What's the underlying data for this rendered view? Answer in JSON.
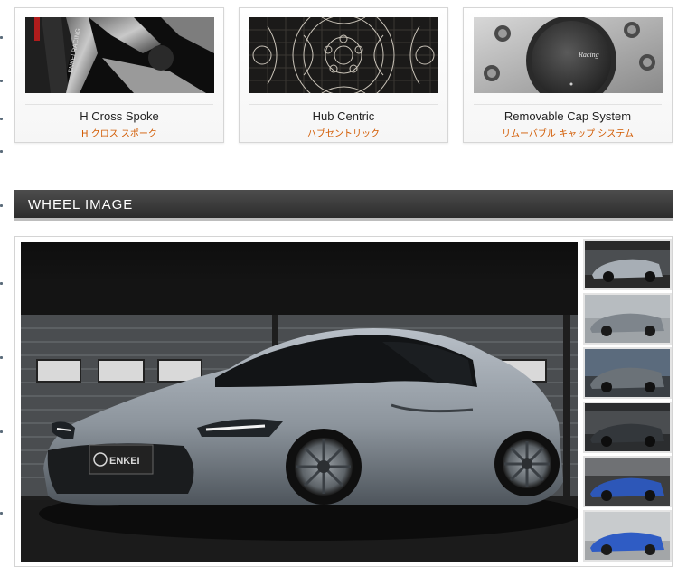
{
  "features": [
    {
      "title": "H Cross Spoke",
      "subtitle": "H クロス スポーク",
      "image": "wheel-spoke-closeup"
    },
    {
      "title": "Hub Centric",
      "subtitle": "ハブセントリック",
      "image": "hub-centric-diagram"
    },
    {
      "title": "Removable Cap System",
      "subtitle": "リムーバブル キャップ システム",
      "image": "wheel-center-cap",
      "cap_text": "Racing"
    }
  ],
  "section": {
    "title": "WHEEL IMAGE"
  },
  "gallery": {
    "main_image": "grey-sports-car-in-garage",
    "plate_text": "ENKEI",
    "thumbnails": [
      {
        "image": "grey-car-garage-front"
      },
      {
        "image": "grey-car-side-studio"
      },
      {
        "image": "grey-car-outdoor"
      },
      {
        "image": "dark-car-garage"
      },
      {
        "image": "blue-car-showroom"
      },
      {
        "image": "blue-car-side"
      }
    ]
  },
  "colors": {
    "accent_orange": "#d25a00",
    "header_dark": "#333333"
  }
}
